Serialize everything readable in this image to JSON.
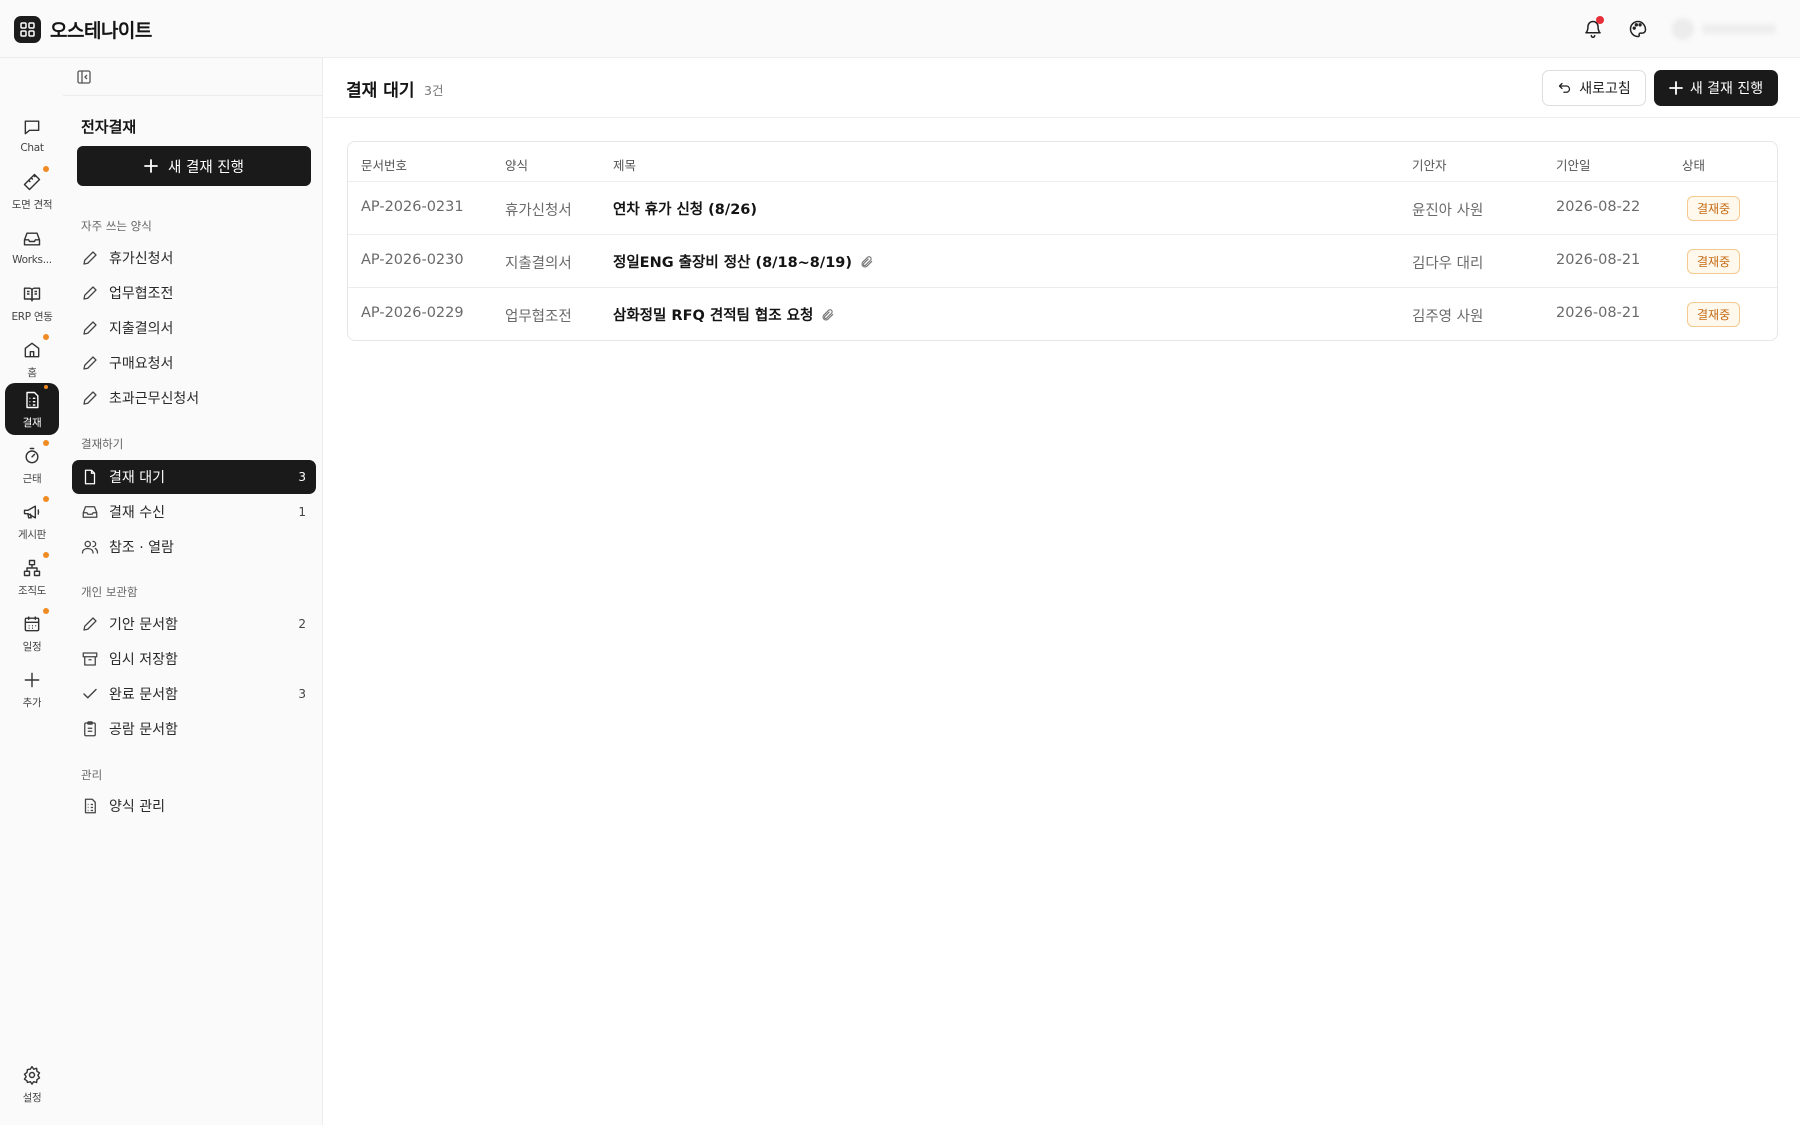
{
  "app": {
    "title": "오스테나이트"
  },
  "rail": {
    "items": [
      {
        "label": "Chat",
        "icon": "chat-icon",
        "dot": false,
        "active": false
      },
      {
        "label": "도면 견적",
        "icon": "ruler-icon",
        "dot": true,
        "active": false
      },
      {
        "label": "Works...",
        "icon": "inbox-icon",
        "dot": false,
        "active": false
      },
      {
        "label": "ERP 연동",
        "icon": "book-icon",
        "dot": false,
        "active": false
      },
      {
        "label": "홈",
        "icon": "home-icon",
        "dot": true,
        "active": false
      },
      {
        "label": "결재",
        "icon": "document-icon",
        "dot": true,
        "active": true
      },
      {
        "label": "근태",
        "icon": "timer-icon",
        "dot": true,
        "active": false
      },
      {
        "label": "게시판",
        "icon": "megaphone-icon",
        "dot": true,
        "active": false
      },
      {
        "label": "조직도",
        "icon": "org-chart-icon",
        "dot": true,
        "active": false
      },
      {
        "label": "일정",
        "icon": "calendar-icon",
        "dot": true,
        "active": false
      },
      {
        "label": "추가",
        "icon": "plus-icon",
        "dot": false,
        "active": false
      }
    ],
    "settings_label": "설정"
  },
  "sidebar": {
    "title": "전자결재",
    "new_button": "새 결재 진행",
    "sections": {
      "frequent": "자주 쓰는 양식",
      "approve": "결재하기",
      "personal": "개인 보관함",
      "manage": "관리"
    },
    "frequent_items": [
      "휴가신청서",
      "업무협조전",
      "지출결의서",
      "구매요청서",
      "초과근무신청서"
    ],
    "approve_items": [
      {
        "label": "결재 대기",
        "count": "3",
        "icon": "file-icon",
        "active": true
      },
      {
        "label": "결재 수신",
        "count": "1",
        "icon": "inbox-icon",
        "active": false
      },
      {
        "label": "참조 · 열람",
        "count": "",
        "icon": "users-icon",
        "active": false
      }
    ],
    "personal_items": [
      {
        "label": "기안 문서함",
        "count": "2",
        "icon": "pencil-icon"
      },
      {
        "label": "임시 저장함",
        "count": "",
        "icon": "archive-icon"
      },
      {
        "label": "완료 문서함",
        "count": "3",
        "icon": "check-icon"
      },
      {
        "label": "공람 문서함",
        "count": "",
        "icon": "clipboard-icon"
      }
    ],
    "manage_items": [
      {
        "label": "양식 관리",
        "icon": "form-icon"
      }
    ]
  },
  "main": {
    "title": "결재 대기",
    "count": "3건",
    "refresh_label": "새로고침",
    "new_label": "새 결재 진행",
    "columns": [
      "문서번호",
      "양식",
      "제목",
      "기안자",
      "기안일",
      "상태"
    ],
    "rows": [
      {
        "doc_no": "AP-2026-0231",
        "form": "휴가신청서",
        "title": "연차 휴가 신청 (8/26)",
        "attachment": false,
        "drafter": "윤진아 사원",
        "date": "2026-08-22",
        "status": "결재중"
      },
      {
        "doc_no": "AP-2026-0230",
        "form": "지출결의서",
        "title": "정일ENG 출장비 정산 (8/18~8/19)",
        "attachment": true,
        "drafter": "김다우 대리",
        "date": "2026-08-21",
        "status": "결재중"
      },
      {
        "doc_no": "AP-2026-0229",
        "form": "업무협조전",
        "title": "삼화정밀 RFQ 견적팀 협조 요청",
        "attachment": true,
        "drafter": "김주영 사원",
        "date": "2026-08-21",
        "status": "결재중"
      }
    ]
  },
  "colors": {
    "accent": "#1a1a1a",
    "status_text": "#c56a12",
    "status_border": "#f3c98f",
    "notification_dot": "#e5303a",
    "rail_dot": "#f08a24"
  }
}
